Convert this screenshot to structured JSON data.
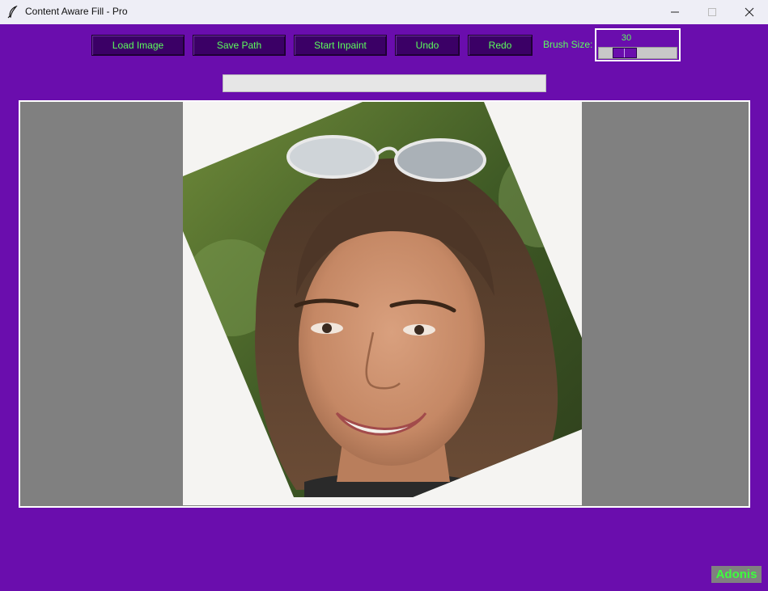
{
  "window": {
    "title": "Content Aware Fill - Pro"
  },
  "toolbar": {
    "load_image": "Load Image",
    "save_path": "Save Path",
    "start_inpaint": "Start Inpaint",
    "undo": "Undo",
    "redo": "Redo",
    "brush_size_label": "Brush Size:",
    "brush_size_value": "30"
  },
  "progress": {
    "value_percent": 0
  },
  "canvas": {
    "background_color": "#808080",
    "image_description_icon": "portrait-photo"
  },
  "watermark": {
    "text": "Adonis"
  },
  "colors": {
    "window_bg": "#6a0dad",
    "button_bg": "#3b0066",
    "button_text": "#5cff5c",
    "watermark_text": "#3cff3c"
  }
}
